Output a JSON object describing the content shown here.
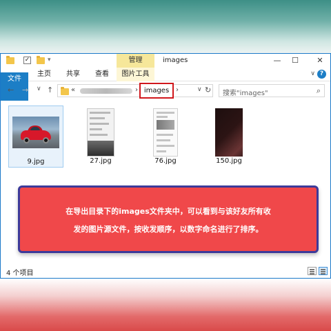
{
  "window": {
    "title": "images",
    "context_tab": "管理",
    "buttons": {
      "minimize": "—",
      "maximize": "☐",
      "close": "✕"
    }
  },
  "ribbon": {
    "tabs": [
      "文件",
      "主页",
      "共享",
      "查看",
      "图片工具"
    ],
    "caret": "∨",
    "help": "?"
  },
  "nav": {
    "back": "←",
    "forward": "→",
    "recent": "∨",
    "up": "↑",
    "address_prefix": "«",
    "address_separator": "›",
    "current_folder": "images",
    "current_separator": "›",
    "dropdown": "∨",
    "refresh": "↻",
    "search_placeholder": "搜索\"images\"",
    "search_icon": "⌕"
  },
  "files": [
    {
      "name": "9.jpg",
      "thumb": "red-car",
      "selected": true
    },
    {
      "name": "27.jpg",
      "thumb": "screen-photo",
      "selected": false
    },
    {
      "name": "76.jpg",
      "thumb": "phone-screenshot",
      "selected": false
    },
    {
      "name": "150.jpg",
      "thumb": "dark-photo",
      "selected": false
    }
  ],
  "status": {
    "item_count": "4 个项目"
  },
  "callout": {
    "line1": "在导出目录下的images文件夹中，可以看到与该好友所有收",
    "line2": "发的图片源文件，按收发顺序，以数字命名进行了排序。"
  },
  "colors": {
    "accent": "#1c7ec6",
    "callout_fill": "#f0484a",
    "callout_border": "#3c3a9a",
    "highlight_border": "#d0171c"
  }
}
